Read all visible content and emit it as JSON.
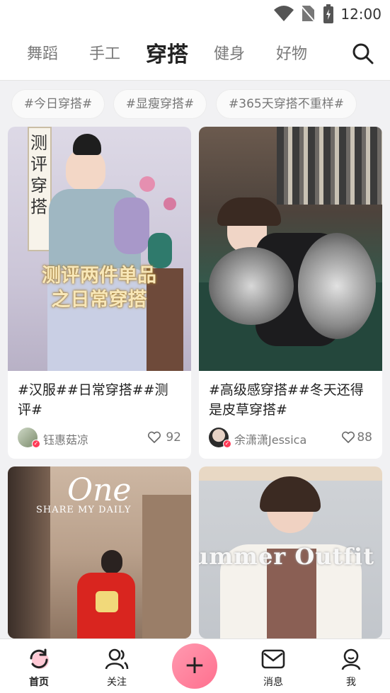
{
  "status_bar": {
    "time": "12:00"
  },
  "tabs": [
    {
      "label": "舞蹈"
    },
    {
      "label": "手工"
    },
    {
      "label": "穿搭",
      "active": true
    },
    {
      "label": "健身"
    },
    {
      "label": "好物"
    }
  ],
  "hashtags": [
    "#今日穿搭#",
    "#显瘦穿搭#",
    "#365天穿搭不重样#"
  ],
  "cards": [
    {
      "overlay_vertical": "测评穿搭",
      "overlay_title_line1": "测评两件单品",
      "overlay_title_line2": "之日常穿搭",
      "caption": "#汉服##日常穿搭##测评#",
      "author": "钰惠菇凉",
      "likes": "92"
    },
    {
      "caption": "#高级感穿搭##冬天还得是皮草穿搭#",
      "author": "余潇潇Jessica",
      "likes": "88"
    },
    {
      "overlay_script": "One",
      "overlay_sub": "SHARE MY DAILY"
    },
    {
      "overlay_text": "ummer Outfit"
    }
  ],
  "bottom_nav": {
    "home": "首页",
    "follow": "关注",
    "messages": "消息",
    "me": "我"
  },
  "colors": {
    "accent": "#ff6f8e",
    "verified": "#ff3b57"
  }
}
